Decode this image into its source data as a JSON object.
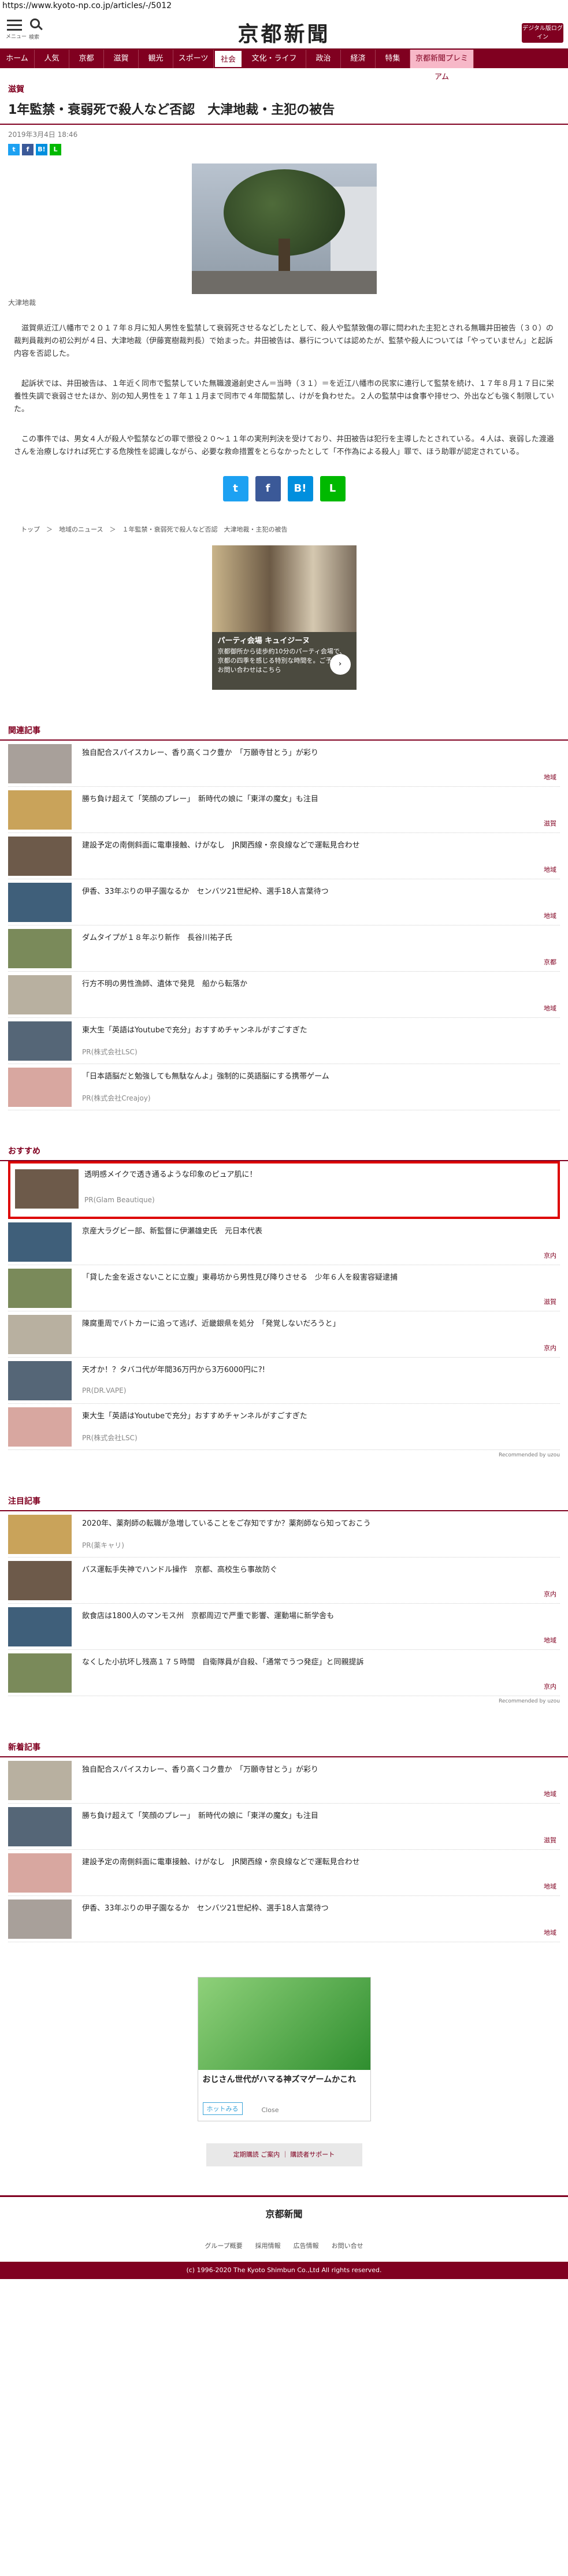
{
  "url": "https://www.kyoto-np.co.jp/articles/-/5012",
  "header": {
    "menu_label": "メニュー",
    "search_label": "検索",
    "logo": "京都新聞",
    "digital": "デジタル版ログイン"
  },
  "nav": [
    "ホーム",
    "人気",
    "京都",
    "滋賀",
    "観光",
    "スポーツ",
    "社会",
    "文化・ライフ",
    "政治",
    "経済",
    "特集",
    "京都新聞プレミアム"
  ],
  "article": {
    "section": "滋賀",
    "title": "1年監禁・衰弱死で殺人など否認　大津地裁・主犯の被告",
    "date": "2019年3月4日 18:46",
    "caption": "大津地裁",
    "p1": "滋賀県近江八幡市で２０１７年８月に知人男性を監禁して衰弱死させるなどしたとして、殺人や監禁致傷の罪に問われた主犯とされる無職井田被告（３０）の裁判員裁判の初公判が４日、大津地裁（伊藤寛樹裁判長）で始まった。井田被告は、暴行については認めたが、監禁や殺人については「やっていません」と起訴内容を否認した。",
    "p2": "起訴状では、井田被告は、１年近く同市で監禁していた無職渡邉創史さん＝当時（３１）＝を近江八幡市の民家に連行して監禁を続け、１７年８月１７日に栄養性失調で衰弱させたほか、別の知人男性を１７年１１月まで同市で４年間監禁し、けがを負わせた。２人の監禁中は食事や排せつ、外出なども強く制限していた。",
    "p3": "この事件では、男女４人が殺人や監禁などの罪で懲役２０～１１年の実刑判決を受けており、井田被告は犯行を主導したとされている。４人は、衰弱した渡邉さんを治療しなければ死亡する危険性を認識しながら、必要な救命措置をとらなかったとして「不作為による殺人」罪で、ほう助罪が認定されている。",
    "crumbs": "トップ　＞　地域のニュース　＞　１年監禁・衰弱死で殺人など否認　大津地裁・主犯の被告"
  },
  "shares": [
    {
      "icon": "twitter-icon",
      "color": "#1da1f2",
      "glyph": "t"
    },
    {
      "icon": "facebook-icon",
      "color": "#3b5998",
      "glyph": "f"
    },
    {
      "icon": "hatena-icon",
      "color": "#008fde",
      "glyph": "B!"
    },
    {
      "icon": "line-icon",
      "color": "#00b900",
      "glyph": "L"
    }
  ],
  "ad1": {
    "title": "パーティ会場 キュイジーヌ",
    "text": "京都御所から徒歩約10分のパーティ会場で、京都の四季を感じる特別な時間を。ご予約・お問い合わせはこちら"
  },
  "sections": {
    "related": {
      "title": "関連記事",
      "items": [
        {
          "text": "独自配合スパイスカレー、香り高くコク豊か　「万願寺甘とう」が彩り",
          "cat": "地域"
        },
        {
          "text": "勝ち負け超えて「笑顔のプレー」　新時代の娘に「東洋の魔女」も注目",
          "cat": "滋賀"
        },
        {
          "text": "建設予定の南側斜面に電車接触、けがなし　JR関西線・奈良線などで運転見合わせ",
          "cat": "地域"
        },
        {
          "text": "伊香、33年ぶりの甲子園なるか　センバツ21世紀枠、選手18人言葉待つ",
          "cat": "地域"
        },
        {
          "text": "ダムタイプが１８年ぶり新作　長谷川祐子氏",
          "cat": "京都"
        },
        {
          "text": "行方不明の男性漁師、遺体で発見　船から転落か",
          "cat": "地域"
        },
        {
          "text": "東大生「英語はYoutubeで充分」おすすめチャンネルがすごすぎた",
          "pr": "PR(株式会社LSC)"
        },
        {
          "text": "「日本語脳だと勉強しても無駄なんよ」強制的に英語脳にする携帯ゲーム",
          "pr": "PR(株式会社Creajoy)"
        }
      ]
    },
    "recommend": {
      "title": "おすすめ",
      "items": [
        {
          "text": "透明感メイクで透き通るような印象のピュア肌に！",
          "pr": "PR(Glam Beautique)"
        },
        {
          "text": "京産大ラグビー部、新監督に伊瀬雄史氏　元日本代表",
          "cat": "京内"
        },
        {
          "text": "「貸した金を返さないことに立腹」東尋坊から男性見び降りさせる　少年６人を殺害容疑逮捕",
          "cat": "滋賀"
        },
        {
          "text": "陳腐重周でバトカーに追って逃げ、近畿銀県を処分　「発覚しないだろうと」",
          "cat": "京内"
        },
        {
          "text": "天才か！？タバコ代が年間36万円から3万6000円に?!",
          "pr": "PR(DR.VAPE)"
        },
        {
          "text": "東大生「英語はYoutubeで充分」おすすめチャンネルがすごすぎた",
          "pr": "PR(株式会社LSC)"
        }
      ],
      "recommended_by": "Recommended by uzou"
    },
    "featured": {
      "title": "注目記事",
      "items": [
        {
          "text": "2020年、薬剤師の転職が急増していることをご存知ですか？薬剤師なら知っておこう",
          "pr": "PR(薬キャリ)"
        },
        {
          "text": "バス運転手失神でハンドル操作　京都、高校生ら事故防ぐ",
          "cat": "京内"
        },
        {
          "text": "飲食店は1800人のマンモス州　京都周辺で严重で影響、運動場に新学舎も",
          "cat": "地域"
        },
        {
          "text": "なくした小抗坏し残高１７５時間　自衛隊員が自殺、「通常でうつ発症」と同親提訴",
          "cat": "京内"
        }
      ],
      "recommended_by": "Recommended by uzou"
    },
    "news": {
      "title": "新着記事",
      "items": [
        {
          "text": "独自配合スパイスカレー、香り高くコク豊か　「万願寺甘とう」が彩り",
          "cat": "地域"
        },
        {
          "text": "勝ち負け超えて「笑顔のプレー」　新時代の娘に「東洋の魔女」も注目",
          "cat": "滋賀"
        },
        {
          "text": "建設予定の南側斜面に電車接触、けがなし　JR関西線・奈良線などで運転見合わせ",
          "cat": "地域"
        },
        {
          "text": "伊香、33年ぶりの甲子園なるか　センバツ21世紀枠、選手18人言葉待つ",
          "cat": "地域"
        }
      ]
    }
  },
  "ad2": {
    "title": "おじさん世代がハマる神ズマゲームかこれ",
    "button": "ホットみる",
    "close": "Close"
  },
  "links": "定期購読 ご案内 ｜ 購読者サポート",
  "footer": {
    "logo": "京都新聞",
    "links": "グループ概要　　採用情報　　広告情報　　お問い合せ",
    "copy": "(c) 1996-2020 The Kyoto Shimbun Co.,Ltd All rights reserved."
  }
}
